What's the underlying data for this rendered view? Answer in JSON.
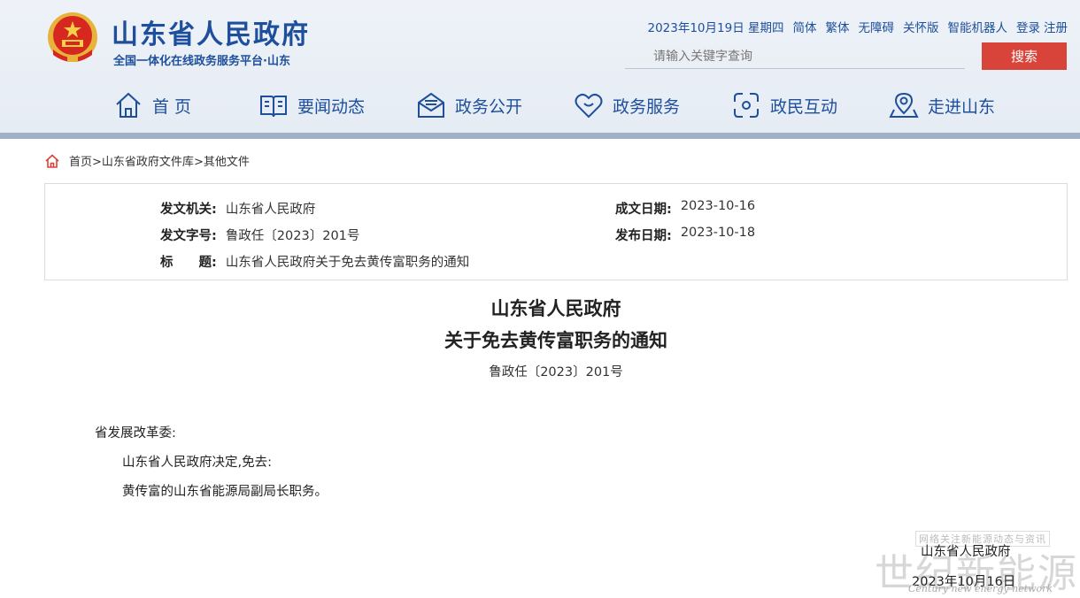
{
  "header": {
    "title": "山东省人民政府",
    "subtitle": "全国一体化在线政务服务平台·山东",
    "emblem_icon": "national-emblem-icon"
  },
  "toplinks": {
    "date": "2023年10月19日 星期四",
    "simplified": "简体",
    "traditional": "繁体",
    "accessible": "无障碍",
    "elder": "关怀版",
    "robot": "智能机器人",
    "login": "登录",
    "register": "注册"
  },
  "search": {
    "placeholder": "请输入关键字查询",
    "button": "搜索"
  },
  "nav": [
    {
      "label": "首 页",
      "icon": "home-icon"
    },
    {
      "label": "要闻动态",
      "icon": "book-icon"
    },
    {
      "label": "政务公开",
      "icon": "envelope-icon"
    },
    {
      "label": "政务服务",
      "icon": "heart-icon"
    },
    {
      "label": "政民互动",
      "icon": "interaction-icon"
    },
    {
      "label": "走进山东",
      "icon": "map-pin-icon"
    }
  ],
  "breadcrumb": {
    "home": "首页",
    "sep1": ">",
    "library": "山东省政府文件库",
    "sep2": ">",
    "current": "其他文件"
  },
  "info": {
    "issuer_key": "发文机关:",
    "issuer_val": "山东省人民政府",
    "docno_key": "发文字号:",
    "docno_val": "鲁政任〔2023〕201号",
    "title_key": "标　　题:",
    "title_val": "山东省人民政府关于免去黄传富职务的通知",
    "created_key": "成文日期:",
    "created_val": "2023-10-16",
    "published_key": "发布日期:",
    "published_val": "2023-10-18"
  },
  "document": {
    "title_line1": "山东省人民政府",
    "title_line2": "关于免去黄传富职务的通知",
    "doc_no": "鲁政任〔2023〕201号",
    "addressee": "省发展改革委:",
    "para1": "山东省人民政府决定,免去:",
    "para2": "黄传富的山东省能源局副局长职务。",
    "sign_org": "山东省人民政府",
    "sign_date": "2023年10月16日"
  },
  "watermark": {
    "small": "网络关注新能源动态与资讯",
    "big": "世纪新能源网",
    "en": "Century new energy network"
  },
  "colors": {
    "brand_blue": "#1d4f9c",
    "search_red": "#d9443a",
    "header_bg": "#e6ecf4"
  }
}
